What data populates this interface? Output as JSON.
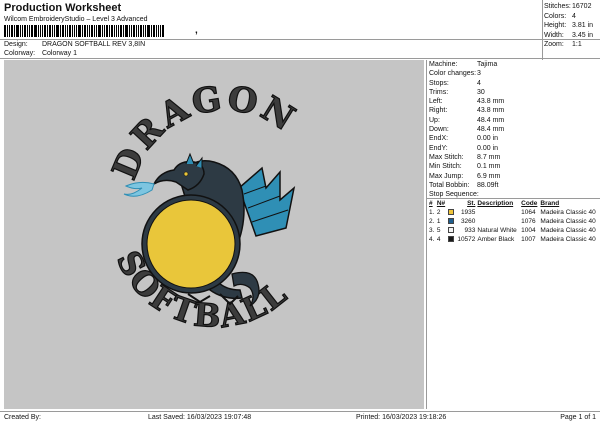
{
  "header": {
    "title": "Production Worksheet",
    "subtitle": "Wilcom EmbroideryStudio – Level 3 Advanced",
    "barcode_label": "Production worksheet barcode",
    "barcode_end": ","
  },
  "design": {
    "design_label": "Design:",
    "design_value": "DRAGON SOFTBALL REV 3,8IN",
    "colorway_label": "Colorway:",
    "colorway_value": "Colorway 1"
  },
  "stats": [
    {
      "k": "Stitches:",
      "v": "16702"
    },
    {
      "k": "Colors:",
      "v": "4"
    },
    {
      "k": "Height:",
      "v": "3.81 in"
    },
    {
      "k": "Width:",
      "v": "3.45 in"
    },
    {
      "k": "Zoom:",
      "v": "1:1"
    }
  ],
  "artwork": {
    "top_text": "DRAGON",
    "bottom_text": "SOFTBALL",
    "colors": {
      "canvas": "#c5c5c5",
      "text": "#3c3c3c",
      "text_outline": "#111111",
      "ball": "#e9c63a",
      "dragon_dark": "#2d3a44",
      "dragon_blue": "#2f8fb5",
      "flame": "#7dc5e0"
    }
  },
  "machine": [
    {
      "k": "Machine:",
      "v": "Tajima"
    },
    {
      "k": "Color changes:",
      "v": "3"
    },
    {
      "k": "Stops:",
      "v": "4"
    },
    {
      "k": "Trims:",
      "v": "30"
    },
    {
      "k": "Left:",
      "v": "43.8 mm"
    },
    {
      "k": "Right:",
      "v": "43.8 mm"
    },
    {
      "k": "Up:",
      "v": "48.4 mm"
    },
    {
      "k": "Down:",
      "v": "48.4 mm"
    },
    {
      "k": "EndX:",
      "v": "0.00 in"
    },
    {
      "k": "EndY:",
      "v": "0.00 in"
    },
    {
      "k": "Max Stitch:",
      "v": "8.7 mm"
    },
    {
      "k": "Min Stitch:",
      "v": "0.1 mm"
    },
    {
      "k": "Max Jump:",
      "v": "6.9 mm"
    },
    {
      "k": "Total Bobbin:",
      "v": "88.09ft"
    }
  ],
  "stop_sequence": {
    "title": "Stop Sequence:",
    "headers": [
      "#",
      "N#",
      "",
      "St.",
      "Description",
      "Code",
      "Brand"
    ],
    "rows": [
      {
        "idx": "1.",
        "n": "2",
        "color": "#f0c53a",
        "st": "1935",
        "desc": "",
        "code": "1064",
        "brand": "Madeira Classic 40"
      },
      {
        "idx": "2.",
        "n": "1",
        "color": "#1f5f8f",
        "st": "3260",
        "desc": "",
        "code": "1076",
        "brand": "Madeira Classic 40"
      },
      {
        "idx": "3.",
        "n": "5",
        "color": "#f4f4f4",
        "st": "933",
        "desc": "Natural White",
        "code": "1004",
        "brand": "Madeira Classic 40"
      },
      {
        "idx": "4.",
        "n": "4",
        "color": "#1a1a1a",
        "st": "10572",
        "desc": "Amber Black",
        "code": "1007",
        "brand": "Madeira Classic 40"
      }
    ]
  },
  "footer": {
    "created_by": "Created By:",
    "last_saved": "Last Saved: 16/03/2023 19:07:48",
    "printed": "Printed: 16/03/2023 19:18:26",
    "page": "Page 1 of 1"
  }
}
